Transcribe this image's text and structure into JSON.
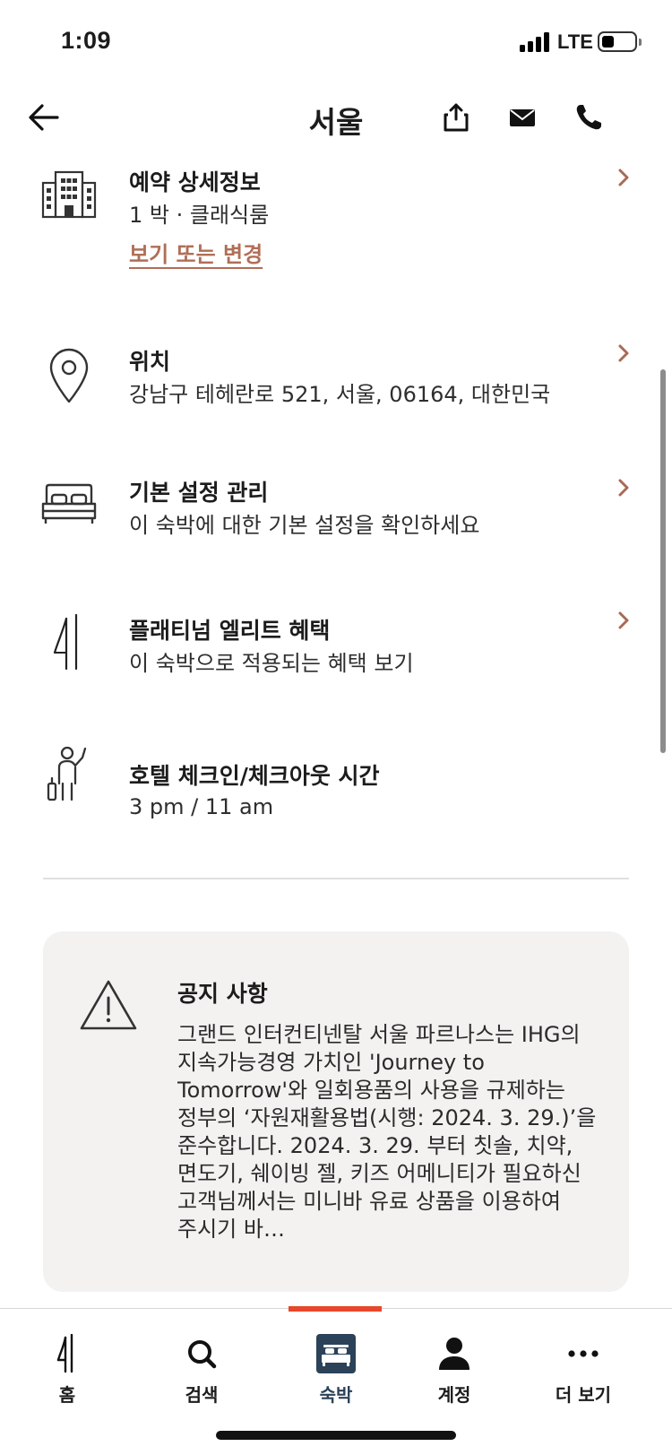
{
  "status_bar": {
    "time": "1:09",
    "network": "LTE",
    "battery_level": 0.35
  },
  "header": {
    "title": "서울",
    "icons": [
      "back-arrow-icon",
      "share-icon",
      "mail-icon",
      "phone-icon"
    ]
  },
  "rows": [
    {
      "icon": "building-icon",
      "title": "예약 상세정보",
      "subtitle": "1 박 · 클래식룸",
      "link": "보기 또는 변경",
      "chevron": true
    },
    {
      "icon": "location-pin-icon",
      "title": "위치",
      "subtitle": "강남구 테헤란로 521, 서울, 06164, 대한민국",
      "chevron": true
    },
    {
      "icon": "bed-icon",
      "title": "기본 설정 관리",
      "subtitle": "이 숙박에 대한 기본 설정을 확인하세요",
      "chevron": true
    },
    {
      "icon": "ic-logo-icon",
      "title": "플래티넘 엘리트 혜택",
      "subtitle": "이 숙박으로 적용되는 혜택 보기",
      "chevron": true
    },
    {
      "icon": "bellhop-icon",
      "title": "호텔 체크인/체크아웃 시간",
      "subtitle": "3 pm / 11 am",
      "chevron": false
    }
  ],
  "notice": {
    "icon": "warning-icon",
    "title": "공지 사항",
    "body": "그랜드 인터컨티넨탈 서울 파르나스는 IHG의 지속가능경영 가치인 'Journey to Tomorrow'와 일회용품의 사용을 규제하는 정부의 ‘자원재활용법(시행: 2024. 3. 29.)’을 준수합니다. 2024. 3. 29. 부터 칫솔, 치약, 면도기, 쉐이빙 젤, 키즈 어메니티가 필요하신 고객님께서는 미니바 유료 상품을 이용하여 주시기 바…"
  },
  "tabbar": {
    "active": "숙박",
    "accent_color": "#e8472b",
    "tabs": [
      {
        "label": "홈",
        "icon": "ic-logo-icon"
      },
      {
        "label": "검색",
        "icon": "search-icon"
      },
      {
        "label": "숙박",
        "icon": "bed-icon"
      },
      {
        "label": "계정",
        "icon": "person-icon"
      },
      {
        "label": "더 보기",
        "icon": "more-dots-icon"
      }
    ]
  },
  "colors": {
    "link": "#b06e56",
    "chevron": "#a86a55",
    "active_tab_bg": "#2b4258"
  }
}
